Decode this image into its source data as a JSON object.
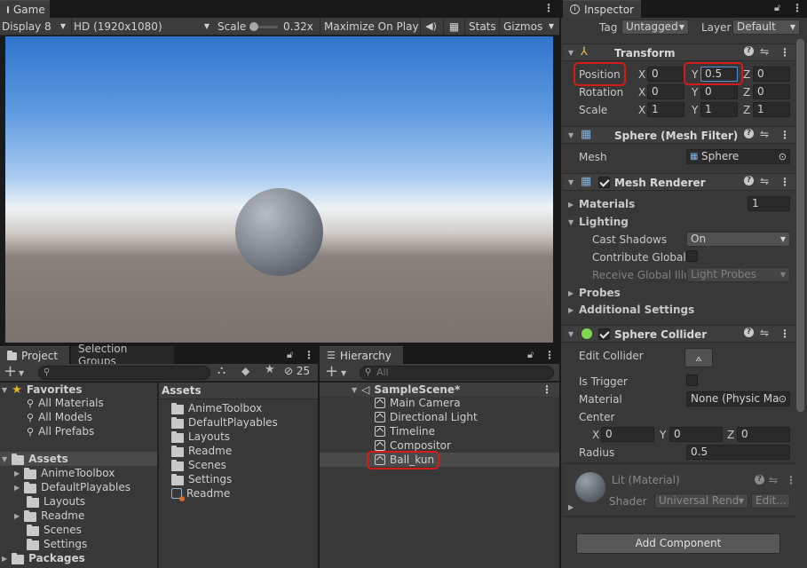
{
  "game": {
    "tab_label": "Game",
    "display": "Display 8",
    "resolution": "HD (1920x1080)",
    "scale_label": "Scale",
    "scale_value": "0.32x",
    "maximize": "Maximize On Play",
    "stats": "Stats",
    "gizmos": "Gizmos"
  },
  "project": {
    "tab_label": "Project",
    "tab2_label": "Selection Groups",
    "hidden_count": "25",
    "favorites": {
      "label": "Favorites",
      "items": [
        "All Materials",
        "All Models",
        "All Prefabs"
      ]
    },
    "assets_tree": {
      "label": "Assets",
      "items": [
        "AnimeToolbox",
        "DefaultPlayables",
        "Layouts",
        "Readme",
        "Scenes",
        "Settings"
      ]
    },
    "packages_label": "Packages",
    "assets_panel": {
      "title": "Assets",
      "items": [
        "AnimeToolbox",
        "DefaultPlayables",
        "Layouts",
        "Readme",
        "Scenes",
        "Settings",
        "Readme"
      ]
    }
  },
  "hierarchy": {
    "tab_label": "Hierarchy",
    "search_placeholder": "All",
    "scene": "SampleScene*",
    "items": [
      "Main Camera",
      "Directional Light",
      "Timeline",
      "Compositor",
      "Ball_kun"
    ]
  },
  "inspector": {
    "tab_label": "Inspector",
    "tag_label": "Tag",
    "tag_value": "Untagged",
    "layer_label": "Layer",
    "layer_value": "Default",
    "transform": {
      "title": "Transform",
      "position_label": "Position",
      "rotation_label": "Rotation",
      "scale_label": "Scale",
      "axis_x": "X",
      "axis_y": "Y",
      "axis_z": "Z",
      "position": [
        "0",
        "0.5",
        "0"
      ],
      "rotation": [
        "0",
        "0",
        "0"
      ],
      "scale": [
        "1",
        "1",
        "1"
      ]
    },
    "mesh_filter": {
      "title": "Sphere (Mesh Filter)",
      "mesh_label": "Mesh",
      "mesh_value": "Sphere"
    },
    "mesh_renderer": {
      "title": "Mesh Renderer",
      "materials_label": "Materials",
      "materials_count": "1",
      "lighting_label": "Lighting",
      "cast_shadows_label": "Cast Shadows",
      "cast_shadows_value": "On",
      "contribute_gi_label": "Contribute Global I",
      "receive_gi_label": "Receive Global Illu",
      "receive_gi_value": "Light Probes",
      "probes_label": "Probes",
      "additional_label": "Additional Settings"
    },
    "sphere_collider": {
      "title": "Sphere Collider",
      "edit_label": "Edit Collider",
      "trigger_label": "Is Trigger",
      "material_label": "Material",
      "material_value": "None (Physic Ma",
      "center_label": "Center",
      "center_x_label": "X",
      "center_y_label": "Y",
      "center_z_label": "Z",
      "center": [
        "0",
        "0",
        "0"
      ],
      "radius_label": "Radius",
      "radius_value": "0.5"
    },
    "material": {
      "name": "Lit (Material)",
      "shader_label": "Shader",
      "shader_value": "Universal Rend",
      "edit_label": "Edit..."
    },
    "add_component": "Add Component"
  },
  "colors": {
    "highlight": "#d41a1a",
    "panel": "#383838",
    "header": "#3e3e3e",
    "field": "#2a2a2a"
  }
}
